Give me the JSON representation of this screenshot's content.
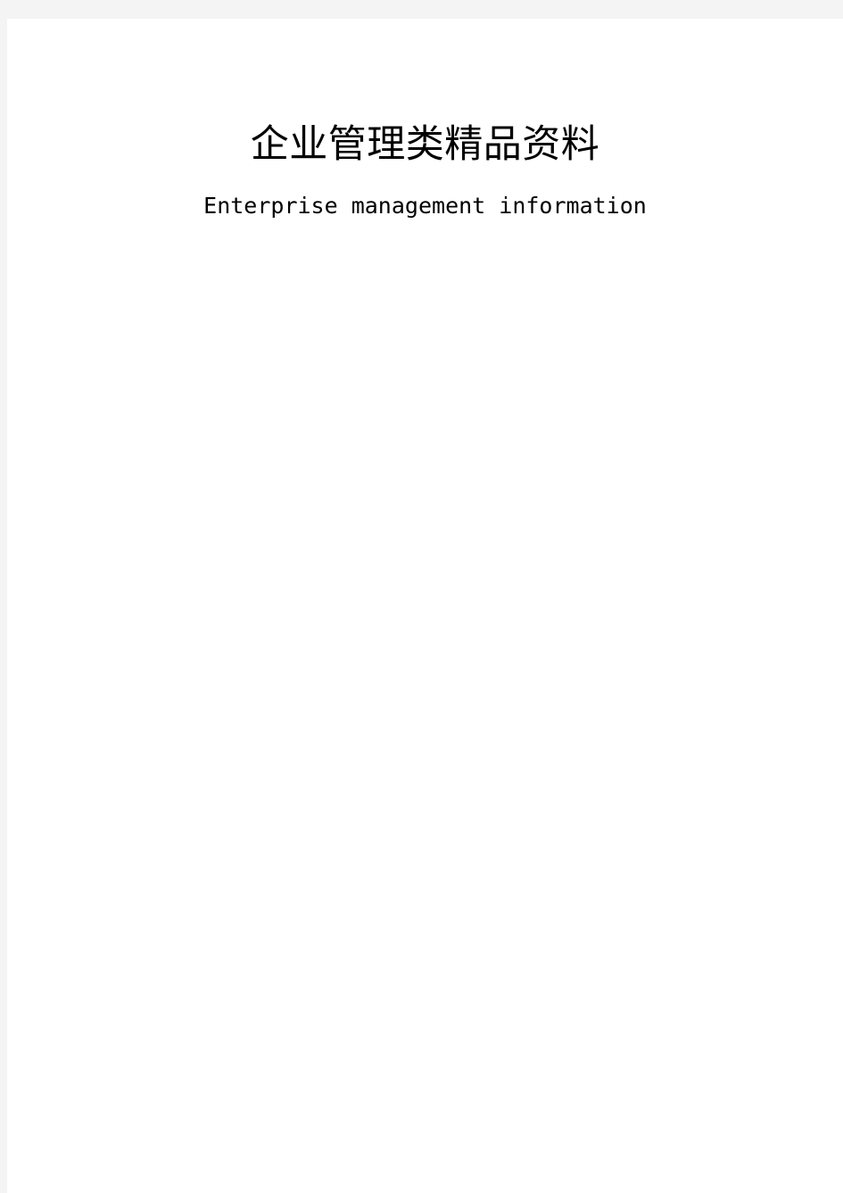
{
  "page": {
    "background_color": "#ffffff",
    "gutter_color": "#f4f4f4",
    "text_color": "#000000"
  },
  "document": {
    "title": "企业管理类精品资料",
    "subtitle": "Enterprise management information"
  }
}
